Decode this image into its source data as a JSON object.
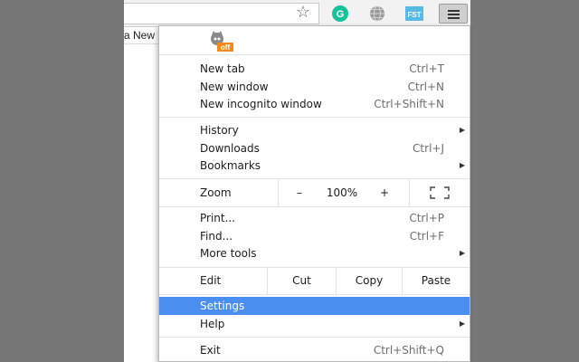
{
  "bookmarks_bar": {
    "partial_item": "a New"
  },
  "toolbar": {
    "star_icon": "star-icon",
    "extensions": [
      "grammarly-icon",
      "globe-icon",
      "fst-icon"
    ],
    "menu_icon": "hamburger-menu-icon",
    "grammarly_letter": "G",
    "fst_text": "FST"
  },
  "menu": {
    "logo_text": "off",
    "new_tab": {
      "label": "New tab",
      "shortcut": "Ctrl+T"
    },
    "new_window": {
      "label": "New window",
      "shortcut": "Ctrl+N"
    },
    "new_incognito": {
      "label": "New incognito window",
      "shortcut": "Ctrl+Shift+N"
    },
    "history": {
      "label": "History"
    },
    "downloads": {
      "label": "Downloads",
      "shortcut": "Ctrl+J"
    },
    "bookmarks": {
      "label": "Bookmarks"
    },
    "zoom": {
      "label": "Zoom",
      "minus": "–",
      "value": "100%",
      "plus": "+"
    },
    "print": {
      "label": "Print...",
      "shortcut": "Ctrl+P"
    },
    "find": {
      "label": "Find...",
      "shortcut": "Ctrl+F"
    },
    "more_tools": {
      "label": "More tools"
    },
    "edit": {
      "label": "Edit",
      "cut": "Cut",
      "copy": "Copy",
      "paste": "Paste"
    },
    "settings": {
      "label": "Settings"
    },
    "help": {
      "label": "Help"
    },
    "exit": {
      "label": "Exit",
      "shortcut": "Ctrl+Shift+Q"
    }
  },
  "colors": {
    "highlight": "#4a8ef0",
    "grammarly": "#15c39a",
    "fst": "#57b9e6",
    "letterbox": "#777777"
  }
}
